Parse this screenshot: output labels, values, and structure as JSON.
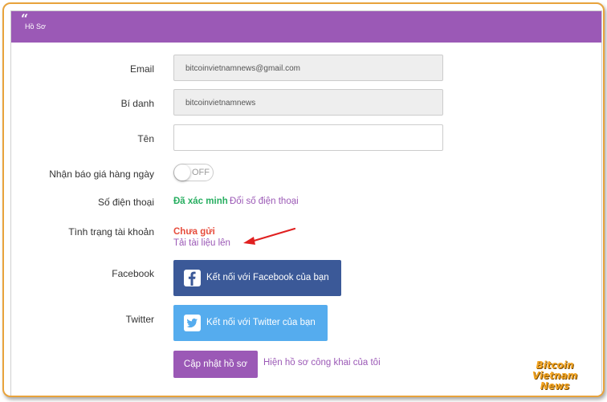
{
  "header": {
    "title": "Hồ Sơ"
  },
  "form": {
    "email_label": "Email",
    "email_value": "bitcoinvietnamnews@gmail.com",
    "nickname_label": "Bí danh",
    "nickname_value": "bitcoinvietnamnews",
    "name_label": "Tên",
    "name_value": "",
    "daily_quote_label": "Nhận báo giá hàng ngày",
    "daily_quote_state": "OFF",
    "phone_label": "Số điện thoại",
    "phone_status": "Đã xác minh",
    "phone_change_link": "Đổi số điện thoại",
    "account_status_label": "Tình trạng tài khoản",
    "account_status_value": "Chưa gửi",
    "upload_docs_link": "Tải tài liệu lên",
    "facebook_label": "Facebook",
    "facebook_button": "Kết nối với Facebook của bạn",
    "twitter_label": "Twitter",
    "twitter_button": "Kết nối với Twitter của bạn",
    "update_button": "Cập nhật hồ sơ",
    "public_profile_link": "Hiện hồ sơ công khai của tôi"
  },
  "watermark": {
    "line1": "Bitcoin Vietnam",
    "line2": "News"
  },
  "colors": {
    "accent": "#9b59b6",
    "verified": "#27ae60",
    "warning": "#e74c3c",
    "facebook": "#3b5998",
    "twitter": "#55acee",
    "frame": "#e8a33c",
    "arrow": "#e02020"
  }
}
